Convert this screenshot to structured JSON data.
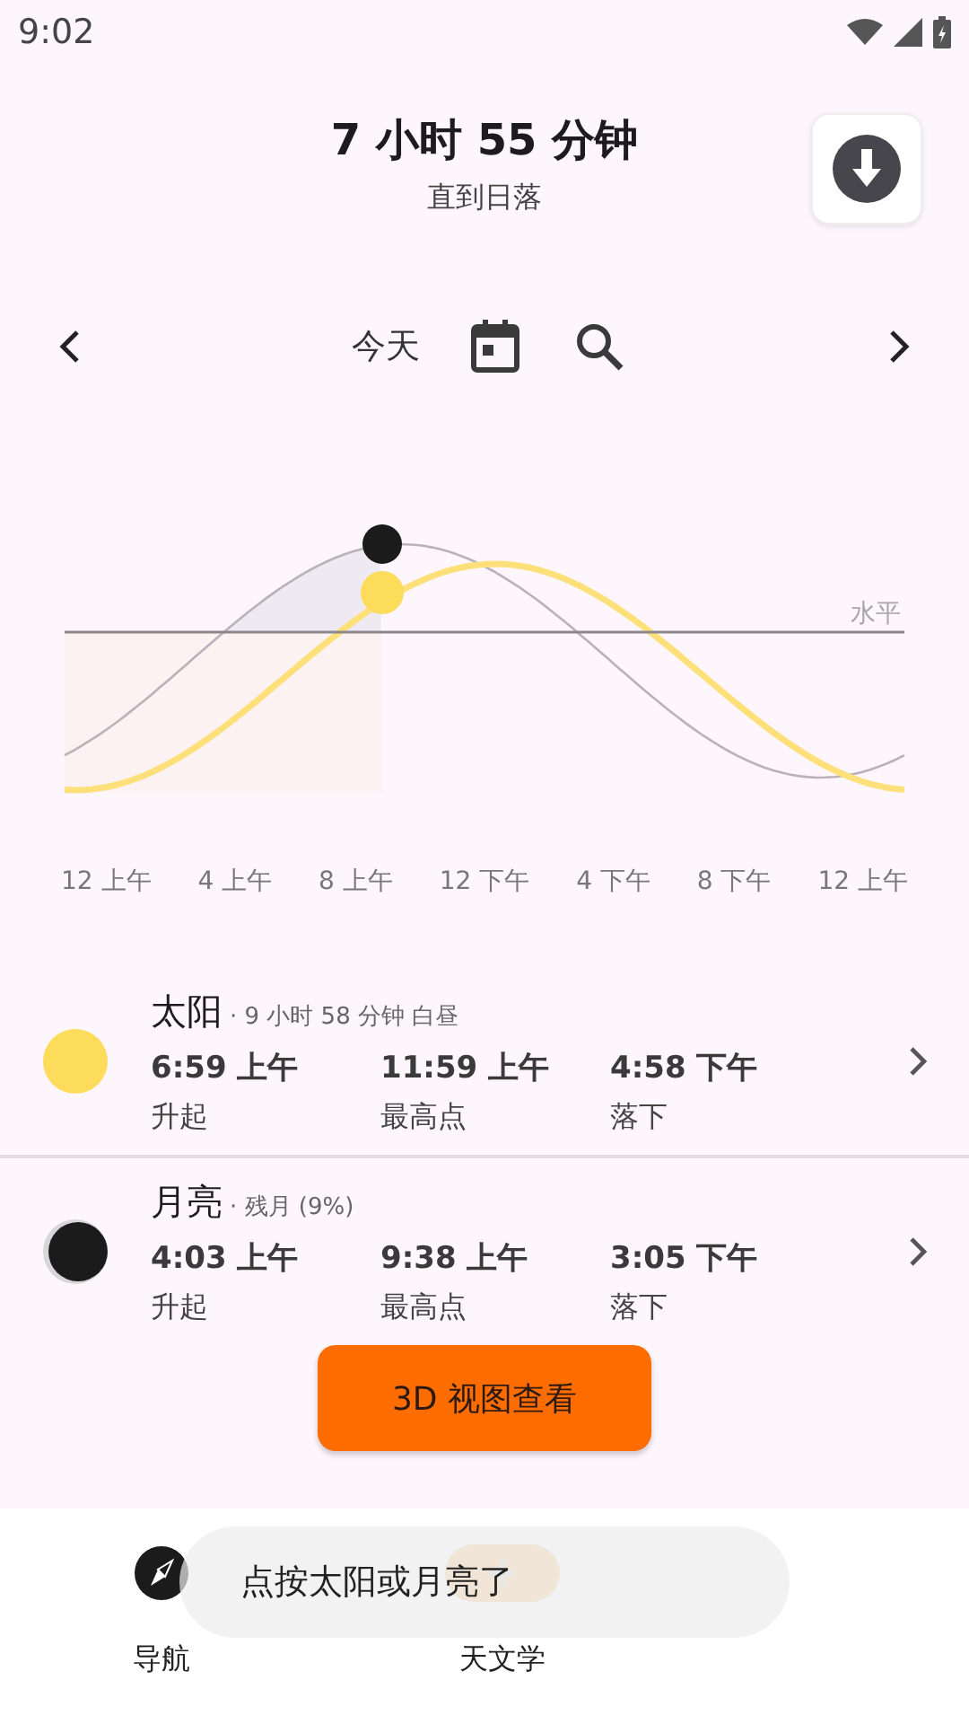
{
  "status_bar": {
    "time": "9:02"
  },
  "header": {
    "title": "7 小时 55 分钟",
    "subtitle": "直到日落"
  },
  "date_nav": {
    "label": "今天"
  },
  "chart": {
    "horizon_label": "水平",
    "x_labels": [
      "12 上午",
      "4 上午",
      "8 上午",
      "12 下午",
      "4 下午",
      "8 下午",
      "12 上午"
    ]
  },
  "bodies": [
    {
      "kind": "sun",
      "name": "太阳",
      "detail": "· 9 小时 58 分钟 白昼",
      "events": [
        {
          "time": "6:59 上午",
          "label": "升起"
        },
        {
          "time": "11:59 上午",
          "label": "最高点"
        },
        {
          "time": "4:58 下午",
          "label": "落下"
        }
      ]
    },
    {
      "kind": "moon",
      "name": "月亮",
      "detail": "· 残月 (9%)",
      "events": [
        {
          "time": "4:03 上午",
          "label": "升起"
        },
        {
          "time": "9:38 上午",
          "label": "最高点"
        },
        {
          "time": "3:05 下午",
          "label": "落下"
        }
      ]
    }
  ],
  "action_button": "3D 视图查看",
  "bottom_nav": [
    {
      "label": "导航",
      "kind": "compass",
      "selected": false
    },
    {
      "label": "天文学",
      "kind": "star",
      "selected": true
    }
  ],
  "toast": "点按太阳或月亮了"
}
